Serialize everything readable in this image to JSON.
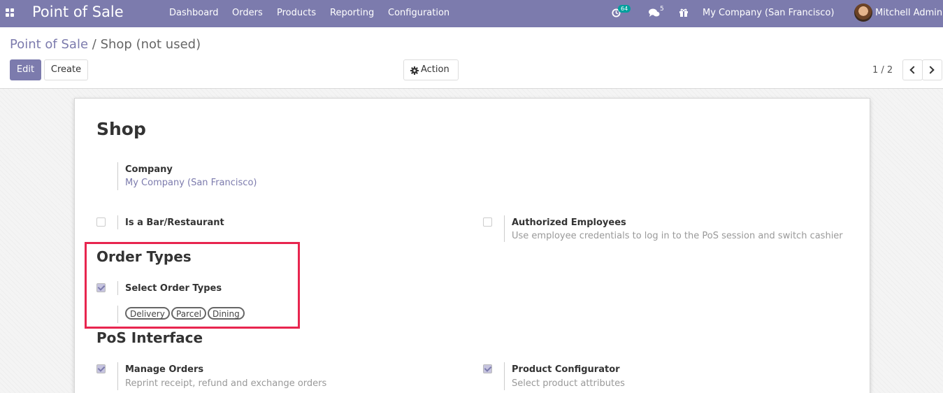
{
  "navbar": {
    "brand": "Point of Sale",
    "menu": [
      "Dashboard",
      "Orders",
      "Products",
      "Reporting",
      "Configuration"
    ],
    "activities_count": "64",
    "messages_count": "5",
    "company": "My Company (San Francisco)",
    "user": "Mitchell Admin"
  },
  "control_panel": {
    "breadcrumb_parent": "Point of Sale",
    "breadcrumb_sep": "/",
    "breadcrumb_current": "Shop (not used)",
    "edit_label": "Edit",
    "create_label": "Create",
    "action_label": "Action",
    "pager": "1 / 2"
  },
  "form": {
    "title": "Shop",
    "company": {
      "label": "Company",
      "value": "My Company (San Francisco)"
    },
    "is_bar": {
      "label": "Is a Bar/Restaurant",
      "checked": false
    },
    "authorized": {
      "label": "Authorized Employees",
      "help": "Use employee credentials to log in to the PoS session and switch cashier",
      "checked": false
    },
    "order_types_section": "Order Types",
    "select_order_types": {
      "label": "Select Order Types",
      "checked": true
    },
    "order_type_tags": [
      "Delivery",
      "Parcel",
      "Dining"
    ],
    "pos_interface_section": "PoS Interface",
    "manage_orders": {
      "label": "Manage Orders",
      "help": "Reprint receipt, refund and exchange orders",
      "checked": true
    },
    "product_configurator": {
      "label": "Product Configurator",
      "help": "Select product attributes",
      "checked": true
    }
  },
  "colors": {
    "brand": "#7c7bad",
    "highlight": "#e8254f",
    "activity_badge": "#00a09d"
  }
}
